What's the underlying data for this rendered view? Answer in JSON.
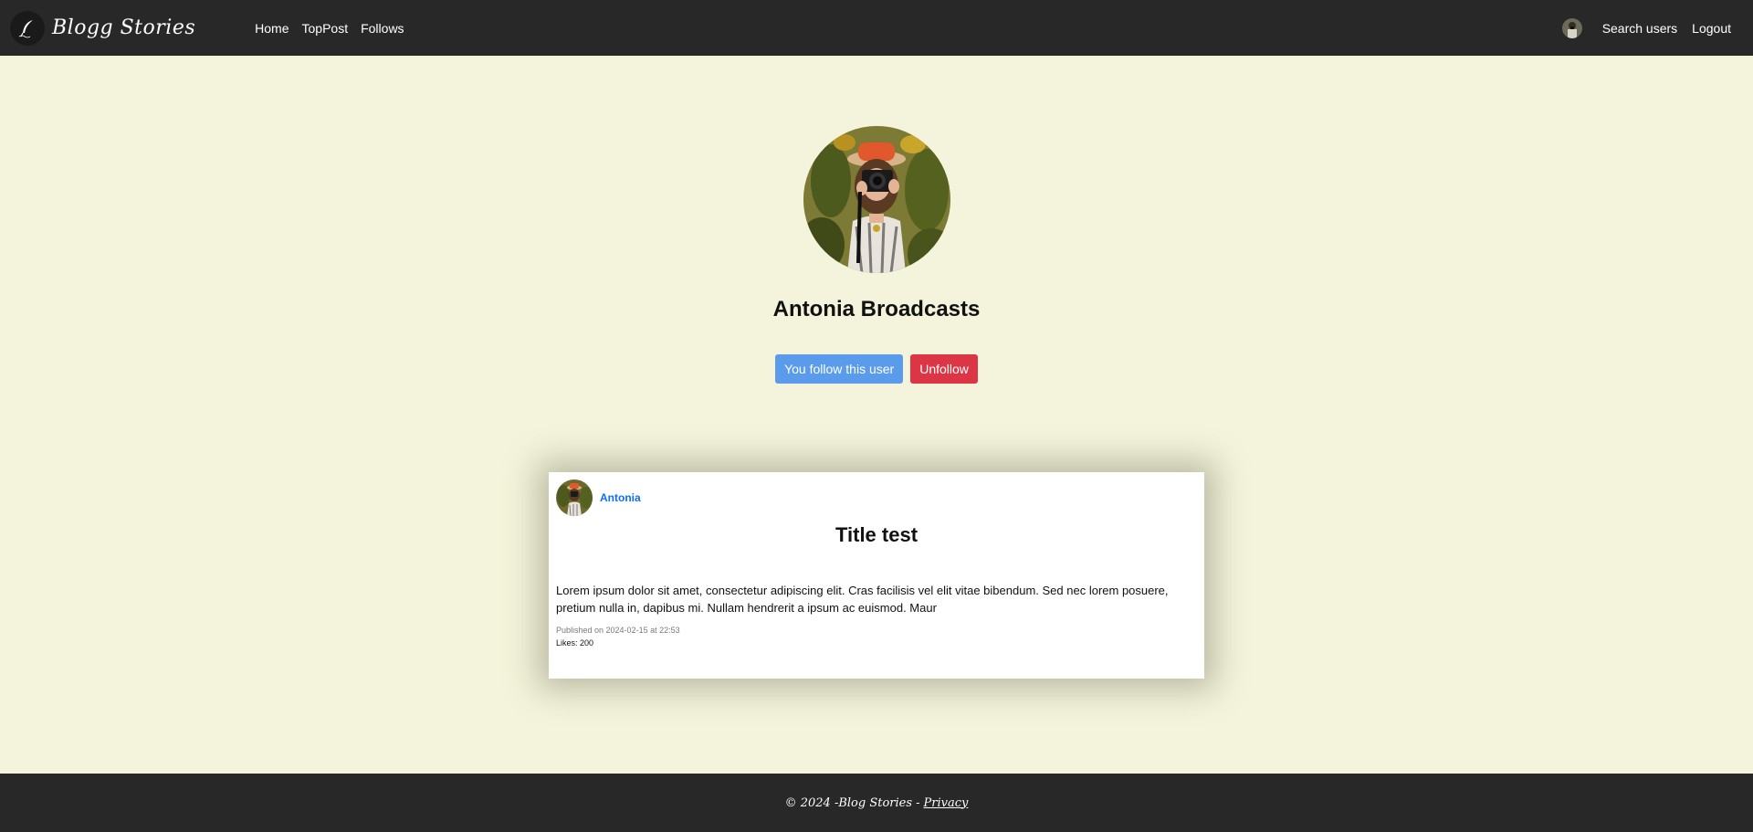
{
  "nav": {
    "brand": "Blogg Stories",
    "links": [
      "Home",
      "TopPost",
      "Follows"
    ],
    "search_users": "Search users",
    "logout": "Logout"
  },
  "profile": {
    "name": "Antonia Broadcasts",
    "follow_status": "You follow this user",
    "unfollow_label": "Unfollow"
  },
  "post": {
    "author": "Antonia",
    "title": "Title test",
    "body": "Lorem ipsum dolor sit amet, consectetur adipiscing elit. Cras facilisis vel elit vitae bibendum. Sed nec lorem posuere, pretium nulla in, dapibus mi. Nullam hendrerit a ipsum ac euismod. Maur",
    "published": "Published on 2024-02-15 at 22:53",
    "likes": "Likes: 200"
  },
  "footer": {
    "copyright": "© 2024 -Blog Stories - ",
    "privacy": "Privacy"
  },
  "colors": {
    "page_bg": "#f4f4dc",
    "nav_bg": "#282828",
    "follow_button": "#5a9bec",
    "unfollow_button": "#dc3545",
    "author_link": "#0d6efd"
  }
}
